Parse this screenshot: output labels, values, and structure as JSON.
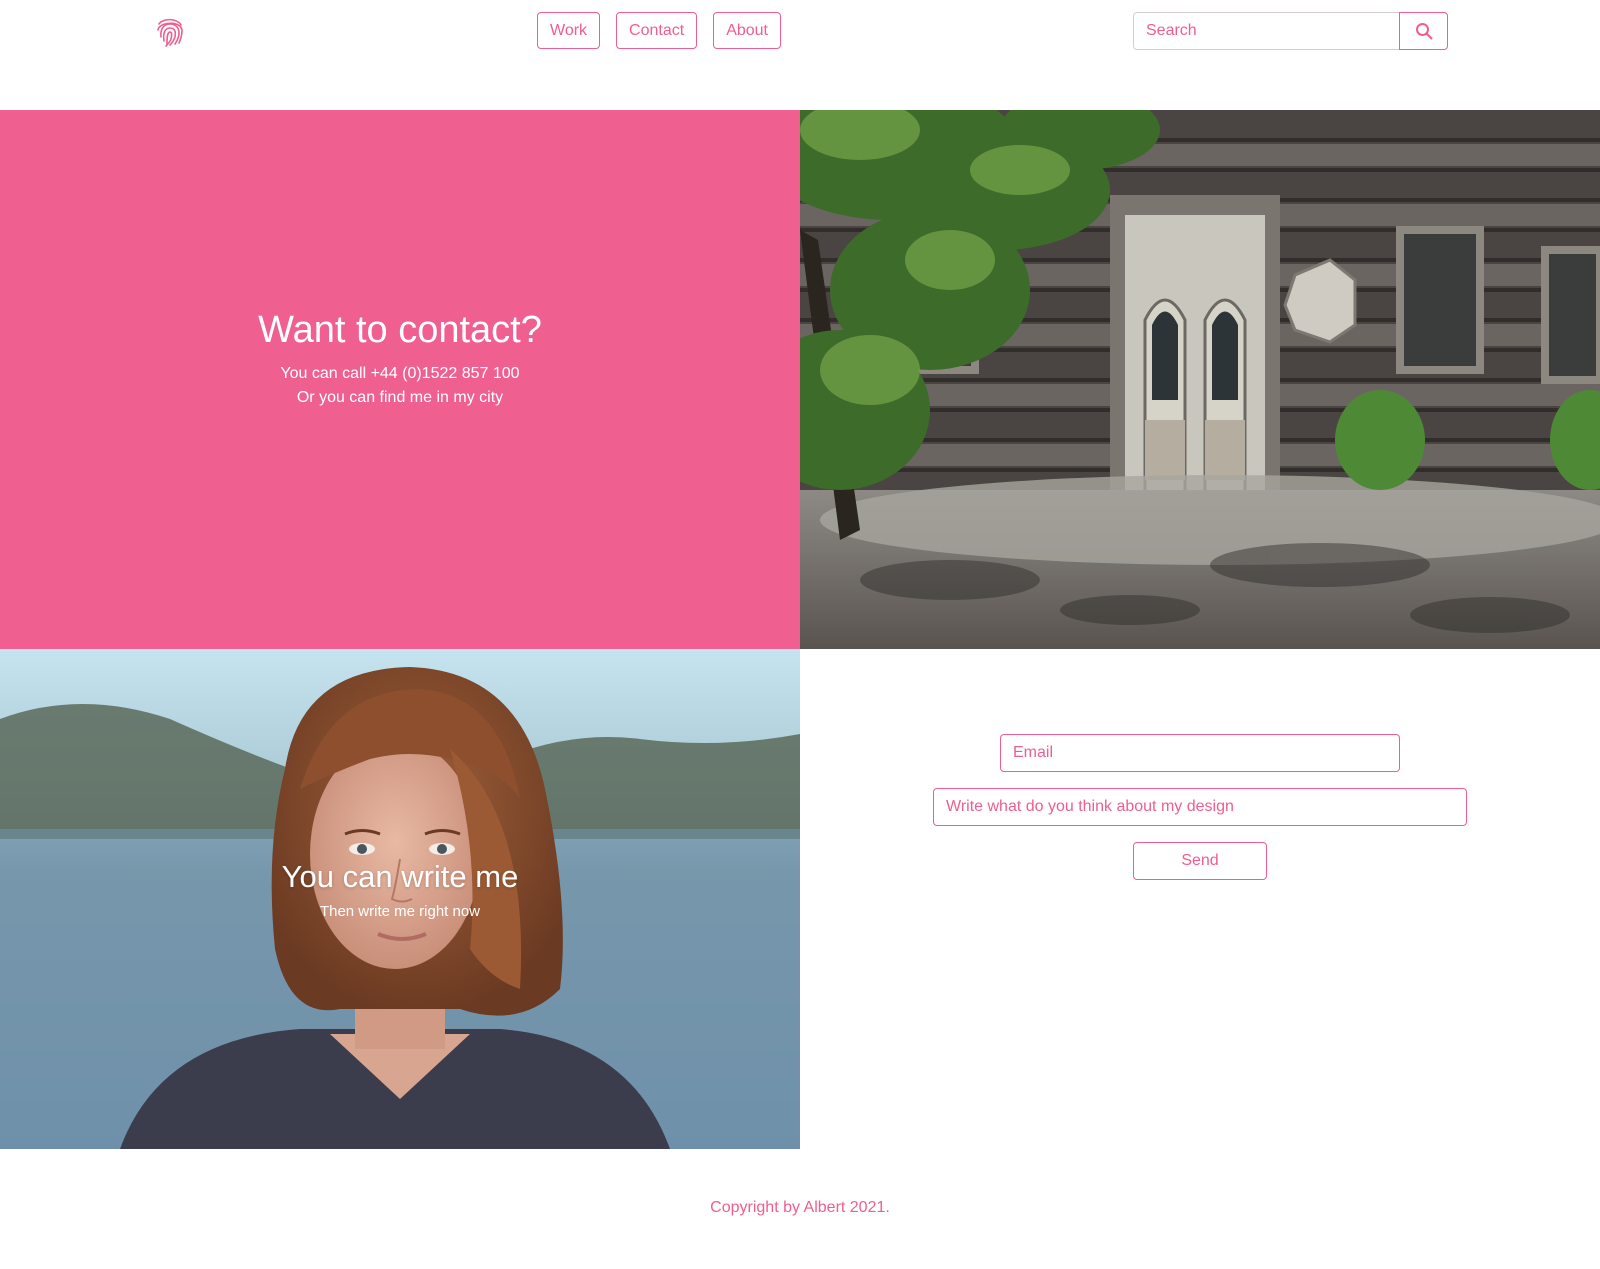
{
  "header": {
    "logo_icon": "fingerprint-icon",
    "nav": [
      {
        "label": "Work"
      },
      {
        "label": "Contact"
      },
      {
        "label": "About"
      }
    ],
    "search": {
      "placeholder": "Search",
      "button_icon": "search-icon"
    }
  },
  "contact": {
    "title": "Want to contact?",
    "phone_line": "You can call +44 (0)1522 857 100",
    "city_line": "Or you can find me in my city"
  },
  "write": {
    "title": "You can write me",
    "subtitle": "Then write me right now"
  },
  "form": {
    "email_placeholder": "Email",
    "message_placeholder": "Write what do you think about my design",
    "send_label": "Send"
  },
  "footer": {
    "copyright": "Copyright by Albert 2021."
  },
  "colors": {
    "accent": "#ef6090",
    "text": "#ef5e8f",
    "background": "#ffffff"
  }
}
